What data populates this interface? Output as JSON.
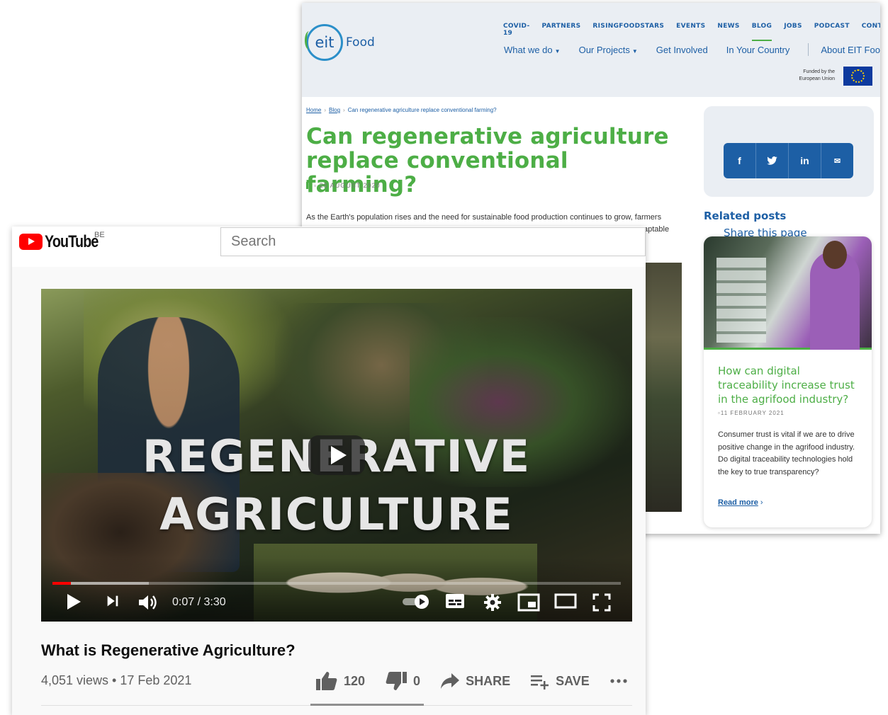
{
  "eit": {
    "logo_mark": "eit",
    "logo_text": "Food",
    "top_nav": [
      "COVID-19",
      "PARTNERS",
      "RISINGFOODSTARS",
      "EVENTS",
      "NEWS",
      "BLOG",
      "JOBS",
      "PODCAST",
      "CONTACT"
    ],
    "main_nav": {
      "what_we_do": "What we do",
      "our_projects": "Our Projects",
      "get_involved": "Get Involved",
      "in_your_country": "In Your Country",
      "about": "About EIT Food"
    },
    "eu_funded": "Funded by the European Union",
    "breadcrumb": {
      "home": "Home",
      "blog": "Blog",
      "current": "Can regenerative agriculture replace conventional farming?"
    },
    "title": "Can regenerative agriculture replace conventional farming?",
    "date": "25 AUGUST 2020",
    "intro": "As the Earth's population rises and the need for sustainable food production continues to grow, farmers",
    "intro_tail": "aptable",
    "share_title": "Share this page",
    "share_buttons": {
      "facebook": "f",
      "twitter": "🐦",
      "linkedin": "in",
      "email": "✉"
    },
    "related_title": "Related posts",
    "card": {
      "title": "How can digital traceability increase trust in the agrifood industry?",
      "date": "11 FEBRUARY 2021",
      "text": "Consumer trust is vital if we are to drive positive change in the agrifood industry. Do digital traceability technologies hold the key to true transparency?",
      "read_more": "Read more"
    },
    "colors": {
      "brand_blue": "#1d5fa5",
      "brand_green": "#4dae46",
      "header_bg": "#eaeef3"
    }
  },
  "youtube": {
    "logo_text": "YouTube",
    "region": "BE",
    "search_placeholder": "Search",
    "overlay_line1": "REGENERATIVE",
    "overlay_line2": "AGRICULTURE",
    "time": "0:07 / 3:30",
    "progress_fraction": 0.033,
    "buffered_fraction": 0.17,
    "video_title": "What is Regenerative Agriculture?",
    "meta": "4,051 views • 17 Feb 2021",
    "likes": "120",
    "dislikes": "0",
    "share_label": "SHARE",
    "save_label": "SAVE",
    "colors": {
      "accent_red": "#ff0000"
    }
  }
}
